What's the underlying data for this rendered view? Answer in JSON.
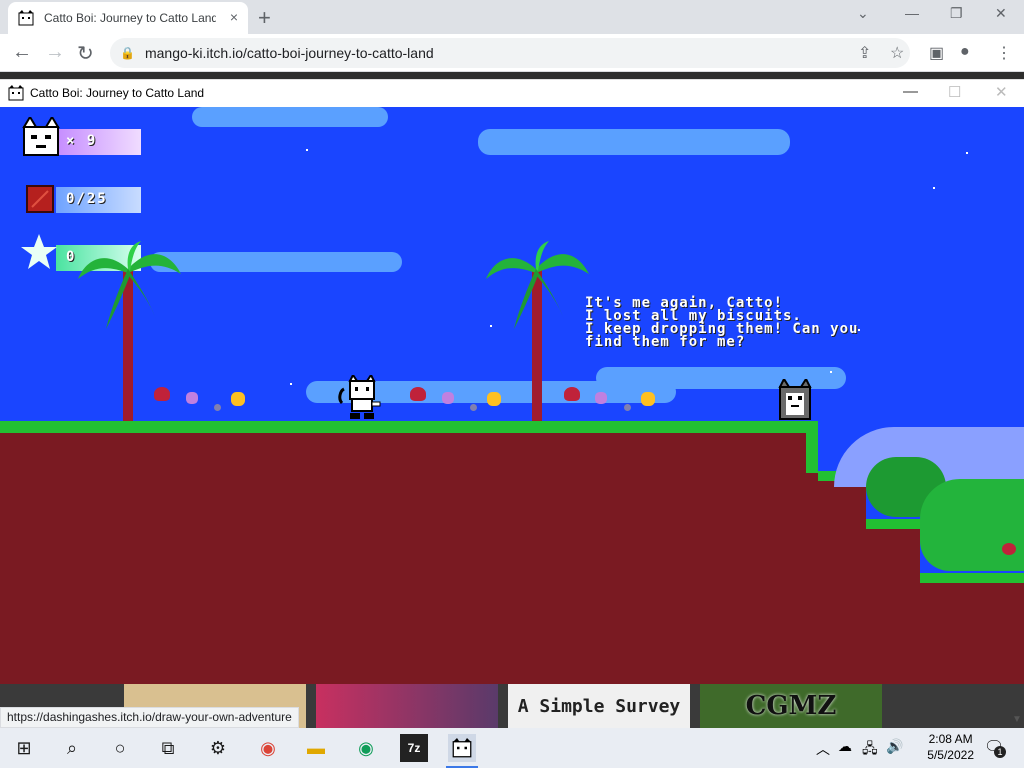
{
  "browser": {
    "tab_title": "Catto Boi: Journey to Catto Land",
    "url": "mango-ki.itch.io/catto-boi-journey-to-catto-land",
    "new_tab": "+",
    "tab_close": "×"
  },
  "game_window": {
    "title": "Catto Boi: Journey to Catto Land"
  },
  "hud": {
    "lives": "× 9",
    "biscuits": "0/25",
    "stars": "0"
  },
  "dialog": "It's me again, Catto!\nI lost all my biscuits.\nI keep dropping them! Can you\nfind them for me?",
  "ads": {
    "survey": "A Simple Survey",
    "cgmz": "CGMZ"
  },
  "status_url": "https://dashingashes.itch.io/draw-your-own-adventure",
  "taskbar": {
    "time": "2:08 AM",
    "date": "5/5/2022",
    "notification_count": "1"
  },
  "colors": {
    "sky": "#1a45ff",
    "cloud": "#5aa0ff",
    "grass": "#22c032",
    "dirt": "#7a1a22"
  }
}
